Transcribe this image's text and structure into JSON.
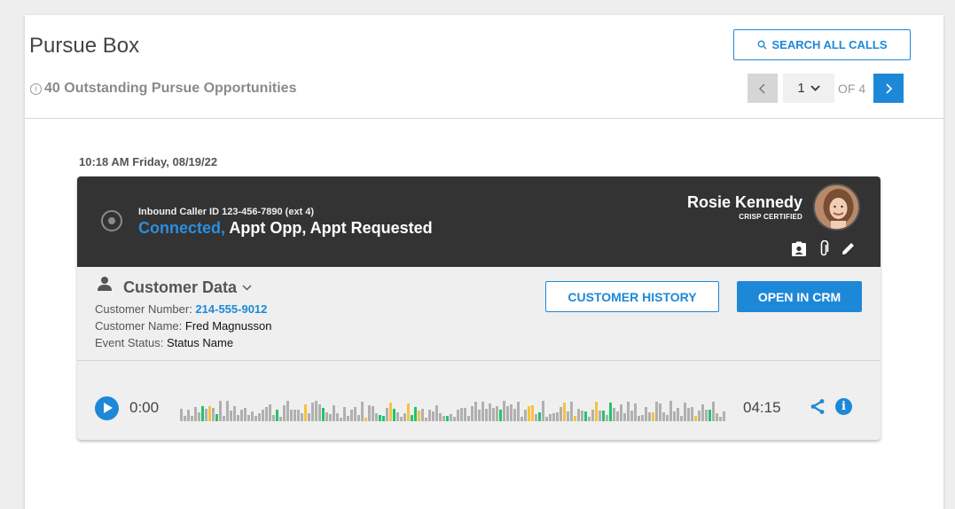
{
  "header": {
    "title": "Pursue Box",
    "info_glyph": "i",
    "subtitle": "40 Outstanding Pursue Opportunities",
    "search_label": "SEARCH ALL CALLS"
  },
  "pagination": {
    "current_page": "1",
    "of_text": "OF 4"
  },
  "call": {
    "timestamp": "10:18 AM Friday, 08/19/22",
    "caller_id": "Inbound Caller ID 123-456-7890 (ext 4)",
    "status_connected": "Connected,",
    "status_rest": " Appt Opp, Appt Requested",
    "agent_name": "Rosie Kennedy",
    "agent_cert": "CRISP CERTIFIED"
  },
  "customer": {
    "section_title": "Customer Data",
    "number_label": "Customer Number: ",
    "number_value": "214-555-9012",
    "name_label": "Customer Name: ",
    "name_value": "Fred Magnusson",
    "status_label": "Event Status: ",
    "status_value": "Status Name",
    "history_button": "CUSTOMER HISTORY",
    "crm_button": "OPEN IN CRM"
  },
  "player": {
    "current_time": "0:00",
    "total_time": "04:15",
    "info_glyph": "i"
  },
  "colors": {
    "accent": "#1e88d8",
    "header_dark": "#333333",
    "wave_gray": "#b0b0b0",
    "wave_green": "#21c46a",
    "wave_yellow": "#f5c342"
  },
  "icons": [
    "info-icon",
    "search-icon",
    "chevron-left-icon",
    "chevron-down-icon",
    "chevron-right-icon",
    "radio-icon",
    "contact-card-icon",
    "paperclip-icon",
    "pencil-icon",
    "person-icon",
    "play-icon",
    "share-icon"
  ]
}
